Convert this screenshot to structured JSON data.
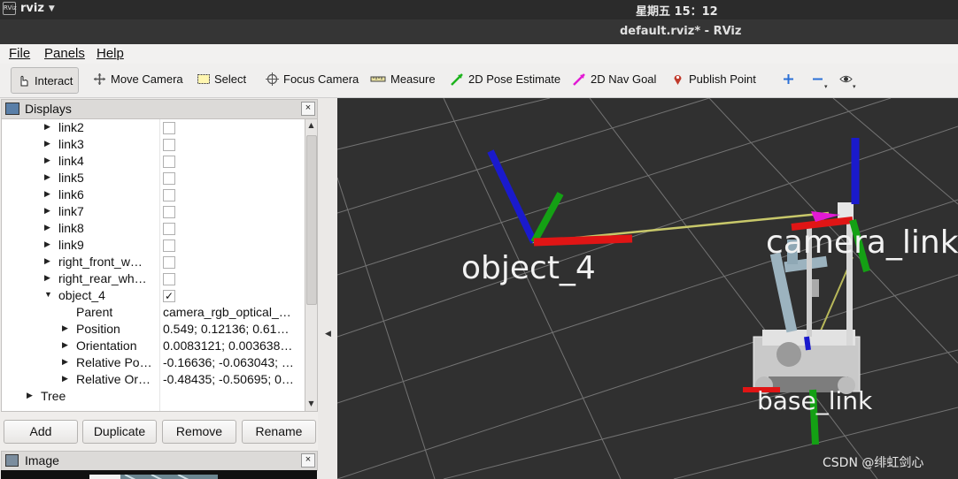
{
  "topbar": {
    "app_icon_text": "RViz",
    "app_name": "rviz",
    "clock": "星期五 15：12"
  },
  "window": {
    "title": "default.rviz* - RViz"
  },
  "menubar": {
    "items": [
      "File",
      "Panels",
      "Help"
    ]
  },
  "toolbar": {
    "tools": [
      {
        "label": "Interact",
        "icon": "hand-pointer-icon"
      },
      {
        "label": "Move Camera",
        "icon": "move-camera-icon"
      },
      {
        "label": "Select",
        "icon": "select-box-icon"
      },
      {
        "label": "Focus Camera",
        "icon": "focus-crosshair-icon"
      },
      {
        "label": "Measure",
        "icon": "ruler-icon"
      },
      {
        "label": "2D Pose Estimate",
        "icon": "green-arrow-icon"
      },
      {
        "label": "2D Nav Goal",
        "icon": "magenta-arrow-icon"
      },
      {
        "label": "Publish Point",
        "icon": "map-pin-icon"
      }
    ]
  },
  "displays_panel": {
    "title": "Displays",
    "rows": [
      {
        "name": "link2",
        "checked": false,
        "value": ""
      },
      {
        "name": "link3",
        "checked": false,
        "value": ""
      },
      {
        "name": "link4",
        "checked": false,
        "value": ""
      },
      {
        "name": "link5",
        "checked": false,
        "value": ""
      },
      {
        "name": "link6",
        "checked": false,
        "value": ""
      },
      {
        "name": "link7",
        "checked": false,
        "value": ""
      },
      {
        "name": "link8",
        "checked": false,
        "value": ""
      },
      {
        "name": "link9",
        "checked": false,
        "value": ""
      },
      {
        "name": "right_front_w…",
        "checked": false,
        "value": ""
      },
      {
        "name": "right_rear_wh…",
        "checked": false,
        "value": ""
      },
      {
        "name": "object_4",
        "checked": true,
        "value": ""
      },
      {
        "name": "Parent",
        "checked": null,
        "value": "camera_rgb_optical_…"
      },
      {
        "name": "Position",
        "checked": null,
        "value": "0.549; 0.12136; 0.61…"
      },
      {
        "name": "Orientation",
        "checked": null,
        "value": "0.0083121; 0.003638…"
      },
      {
        "name": "Relative Po…",
        "checked": null,
        "value": "-0.16636; -0.063043; …"
      },
      {
        "name": "Relative Or…",
        "checked": null,
        "value": "-0.48435; -0.50695; 0…"
      },
      {
        "name": "Tree",
        "checked": null,
        "value": ""
      }
    ],
    "buttons": [
      "Add",
      "Duplicate",
      "Remove",
      "Rename"
    ]
  },
  "image_panel": {
    "title": "Image"
  },
  "viewport": {
    "labels": [
      "object_4",
      "camera_link",
      "base_link"
    ],
    "watermark": "CSDN @绯虹剑心",
    "background_color": "#303030"
  }
}
